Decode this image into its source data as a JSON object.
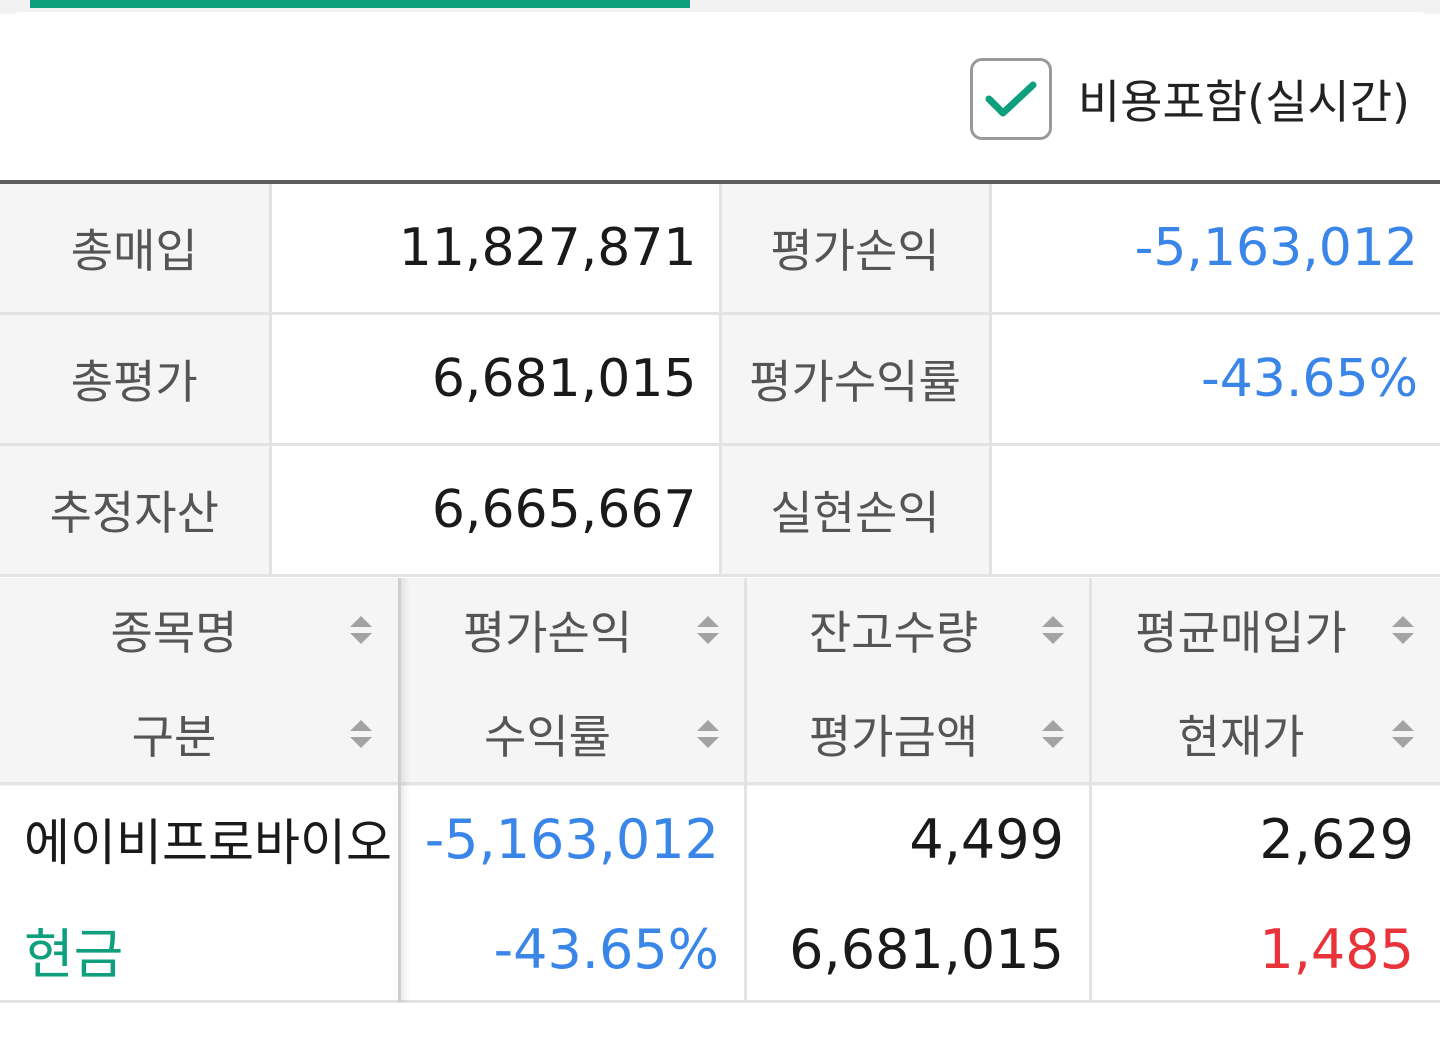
{
  "checkbox": {
    "label": "비용포함(실시간)",
    "checked": true,
    "icon": "check-icon",
    "accent": "#0e9f7d"
  },
  "summary": {
    "rows": [
      {
        "label1": "총매입",
        "value1": "11,827,871",
        "label2": "평가손익",
        "value2": "-5,163,012"
      },
      {
        "label1": "총평가",
        "value1": "6,681,015",
        "label2": "평가수익률",
        "value2": "-43.65%"
      },
      {
        "label1": "추정자산",
        "value1": "6,665,667",
        "label2": "실현손익",
        "value2": ""
      }
    ]
  },
  "holdings": {
    "headers": [
      {
        "top": "종목명",
        "bottom": "구분"
      },
      {
        "top": "평가손익",
        "bottom": "수익률"
      },
      {
        "top": "잔고수량",
        "bottom": "평가금액"
      },
      {
        "top": "평균매입가",
        "bottom": "현재가"
      }
    ],
    "rows": [
      {
        "name": "에이비프로바이오",
        "type": "현금",
        "pnl": "-5,163,012",
        "rate": "-43.65%",
        "qty": "4,499",
        "eval_amount": "6,681,015",
        "avg_price": "2,629",
        "current_price": "1,485"
      }
    ]
  },
  "colors": {
    "negative": "#3a86e8",
    "price_down": "#e8333a",
    "accent": "#0e9f7d"
  }
}
